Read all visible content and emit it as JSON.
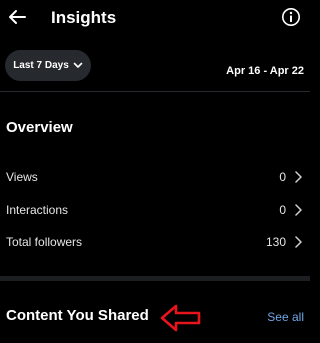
{
  "header": {
    "title": "Insights",
    "back_icon": "arrow-left-icon",
    "info_icon": "info-icon"
  },
  "filter": {
    "range_label": "Last 7 Days",
    "dropdown_icon": "chevron-down-icon",
    "date_range": "Apr 16 - Apr 22"
  },
  "overview": {
    "title": "Overview",
    "rows": [
      {
        "label": "Views",
        "value": "0"
      },
      {
        "label": "Interactions",
        "value": "0"
      },
      {
        "label": "Total followers",
        "value": "130"
      }
    ]
  },
  "content_shared": {
    "title": "Content You Shared",
    "see_all": "See all"
  },
  "annotation": {
    "icon": "left-arrow-outline-icon",
    "color": "#e8141c"
  },
  "colors": {
    "background": "#000000",
    "pill": "#26292e",
    "link": "#6fa7e7"
  }
}
